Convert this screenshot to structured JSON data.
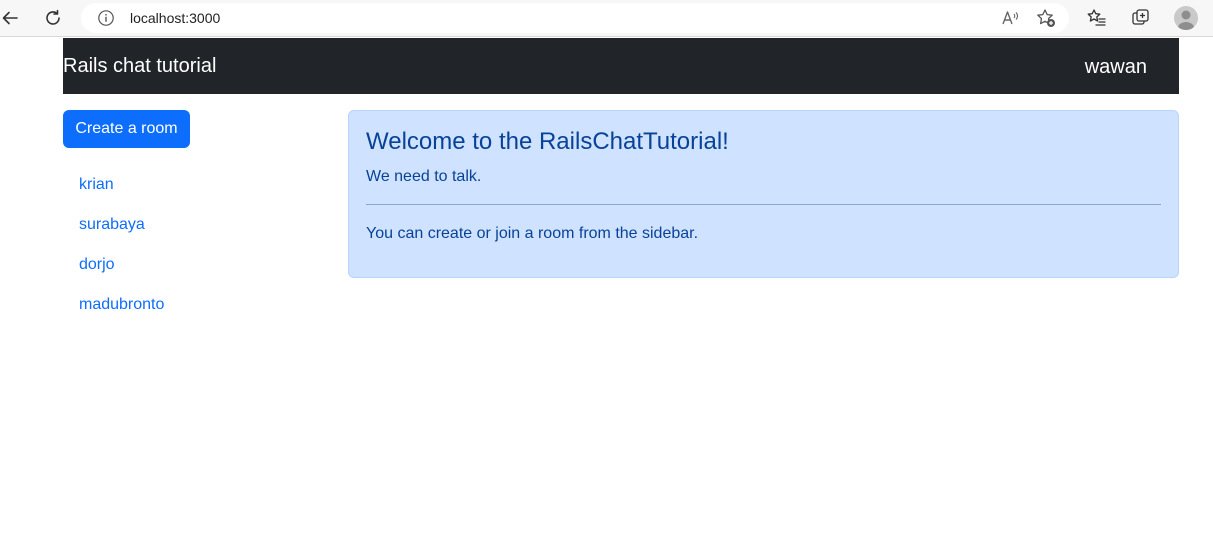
{
  "browser": {
    "url": "localhost:3000",
    "back_icon": "arrow-left-icon",
    "reload_icon": "reload-icon",
    "info_icon": "info-icon",
    "read_aloud_icon": "read-aloud-icon",
    "add_favorite_icon": "star-plus-icon",
    "favorites_icon": "favorites-list-icon",
    "collections_icon": "collections-icon",
    "profile_icon": "profile-avatar-icon"
  },
  "navbar": {
    "brand": "Rails chat tutorial",
    "user": "wawan",
    "background": "#212529"
  },
  "sidebar": {
    "create_button": "Create a room",
    "rooms": [
      {
        "label": "krian"
      },
      {
        "label": "surabaya"
      },
      {
        "label": "dorjo"
      },
      {
        "label": "madubronto"
      }
    ],
    "accent": "#0d6efd"
  },
  "alert": {
    "heading": "Welcome to the RailsChatTutorial!",
    "text1": "We need to talk.",
    "text2": "You can create or join a room from the sidebar.",
    "background": "#cfe2ff",
    "text_color": "#084298"
  }
}
